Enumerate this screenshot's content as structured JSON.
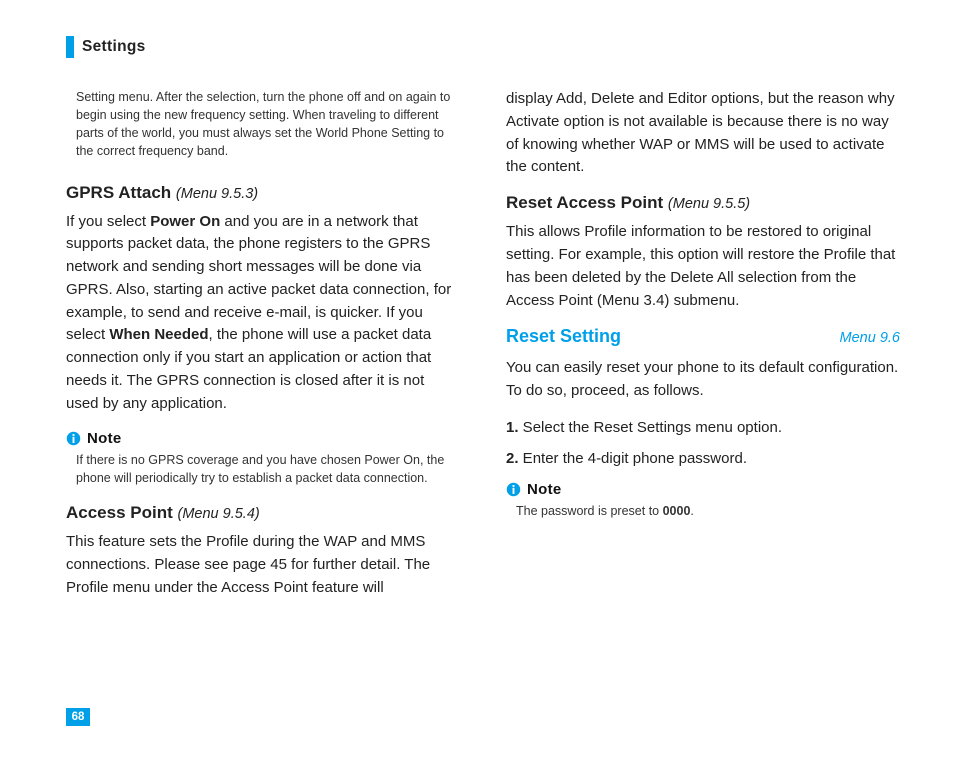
{
  "header": {
    "title": "Settings"
  },
  "page_number": "68",
  "left": {
    "intro": "Setting menu. After the selection, turn the phone off and on again to begin using the new frequency setting. When traveling to different parts of the world, you must always set the World Phone Setting to the correct frequency band.",
    "gprs": {
      "title": "GPRS Attach",
      "menu": "(Menu 9.5.3)",
      "p1a": "If you select ",
      "p1b_strong": "Power On",
      "p1c": " and you are in a network that supports packet data, the phone registers to the GPRS network and sending short messages will be done via GPRS. Also, starting an active packet data connection, for example, to send and receive e-mail, is quicker. If you select ",
      "p1d_strong": "When Needed",
      "p1e": ", the phone will use a packet data connection only if you start an application or action that needs it. The GPRS connection is closed after it is not used by any application."
    },
    "note1": {
      "label": "Note",
      "body": "If there is no GPRS coverage and you have chosen Power On, the phone will periodically try to establish a packet data connection."
    },
    "access": {
      "title": "Access Point",
      "menu": "(Menu 9.5.4)",
      "p": "This feature sets the Profile during the WAP and MMS connections.  Please see page 45 for further detail. The Profile menu under the Access Point feature will"
    }
  },
  "right": {
    "cont": "display Add, Delete and Editor options, but the reason why Activate option is not available is because there is no way of knowing whether WAP or MMS will be used to activate the content.",
    "reset_ap": {
      "title": "Reset Access Point",
      "menu": "(Menu 9.5.5)",
      "p": "This allows Profile information to be restored to original setting. For example, this option will restore the Profile that has been deleted by the Delete All selection from the Access Point (Menu 3.4) submenu."
    },
    "reset_setting": {
      "title": "Reset Setting",
      "menu": "Menu 9.6",
      "p": "You can easily reset your phone to its default configuration. To do so, proceed, as follows.",
      "steps": {
        "n1": "1.",
        "s1": " Select the Reset Settings menu option.",
        "n2": "2.",
        "s2": " Enter the 4-digit phone password."
      }
    },
    "note2": {
      "label": "Note",
      "body_a": "The password is preset to ",
      "body_b_strong": "0000",
      "body_c": "."
    }
  }
}
